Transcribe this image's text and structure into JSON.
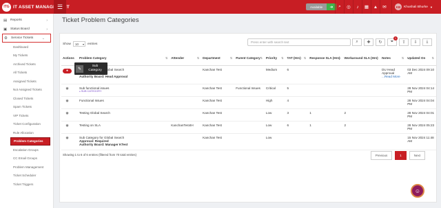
{
  "app": {
    "logo_badge": "ITG",
    "logo_text": "IT ASSET MANAGEMENT"
  },
  "topbar": {
    "availability": "Available",
    "icons": [
      "search-icon",
      "target-icon",
      "bell-icon",
      "calendar-icon",
      "alert-icon",
      "chat-icon",
      "phone-icon",
      "message-icon"
    ],
    "user_initials": "KB",
    "user_name": "Khushali Bhurke"
  },
  "sidebar": {
    "items": [
      {
        "label": "Reports",
        "icon": "chart-icon"
      },
      {
        "label": "Status Board",
        "icon": "board-icon"
      },
      {
        "label": "Service Tickets",
        "icon": "ticket-icon"
      }
    ],
    "subitems": [
      "Dashboard",
      "My Tickets",
      "Archived Tickets",
      "All Tickets",
      "Assigned Tickets",
      "Not Assigned Tickets",
      "Closed Tickets",
      "Spam Tickets",
      "VIP Tickets",
      "Ticket Configuration",
      "Rule Allocation",
      "Problem Categories",
      "Escalation Groups",
      "CC Email Groups",
      "Problem Management",
      "Ticket Scheduler",
      "Ticket Triggers"
    ]
  },
  "page": {
    "title": "Ticket Problem Categories"
  },
  "toolbar": {
    "show_label": "Show",
    "entries_value": "10",
    "entries_label": "entries",
    "search_placeholder": "Press enter with search text",
    "notification_count": "1"
  },
  "table": {
    "headers": [
      "Actions",
      "Problem Category",
      "Attender",
      "Department",
      "Parent Category",
      "Priority",
      "TAT (Hrs)",
      "Response SLA (Hrs)",
      "Workaround SLA (Hrs)",
      "Notes",
      "Updated On"
    ],
    "rows": [
      {
        "category": "Sub Category for Global Search",
        "category_line2": "Approval: Required",
        "category_line3": "Authority Board: Head Approval",
        "attender": "",
        "department": "Kanchan Test",
        "parent": "",
        "priority": "Medium",
        "tat": "6",
        "response": "",
        "workaround": "",
        "notes": "DU Head Approval",
        "notes_more": "...Read More",
        "updated": "03 Dec 2024 09:10 AM"
      },
      {
        "category": "Sub functional issues",
        "sub_label": "SUB CATEGORY",
        "attender": "",
        "department": "Kanchan Test",
        "parent": "Functional Issues",
        "priority": "Critical",
        "tat": "5",
        "response": "",
        "workaround": "",
        "notes": "",
        "updated": "28 Nov 2024 04:14 PM"
      },
      {
        "category": "Functional Issues",
        "attender": "",
        "department": "Kanchan Test",
        "parent": "",
        "priority": "High",
        "tat": "4",
        "response": "",
        "workaround": "",
        "notes": "",
        "updated": "28 Nov 2024 04:04 PM"
      },
      {
        "category": "Testing Global Search",
        "attender": "",
        "department": "Kanchan Test",
        "parent": "",
        "priority": "Low",
        "tat": "3",
        "response": "1",
        "workaround": "2",
        "notes": "",
        "updated": "28 Nov 2024 04:01 PM"
      },
      {
        "category": "Testing on SLA",
        "attender": "KanchanTest4H",
        "department": "Kanchan Test",
        "parent": "",
        "priority": "Low",
        "tat": "6",
        "response": "1",
        "workaround": "2",
        "notes": "",
        "updated": "28 Nov 2024 05:23 PM"
      },
      {
        "category": "Sub Category for Global Search",
        "category_line2": "Approval: Required",
        "category_line3": "Authority Board: Manager KTest",
        "attender": "",
        "department": "Kanchan Test",
        "parent": "",
        "priority": "Low",
        "tat": "",
        "response": "",
        "workaround": "",
        "notes": "",
        "updated": "15 Nov 2024 11:48 AM"
      }
    ]
  },
  "popup": {
    "label": "Sub Category"
  },
  "footer": {
    "info": "Showing 1 to 6 of 6 entries (filtered from 70 total entries)",
    "prev": "Previous",
    "page": "1",
    "next": "Next"
  }
}
